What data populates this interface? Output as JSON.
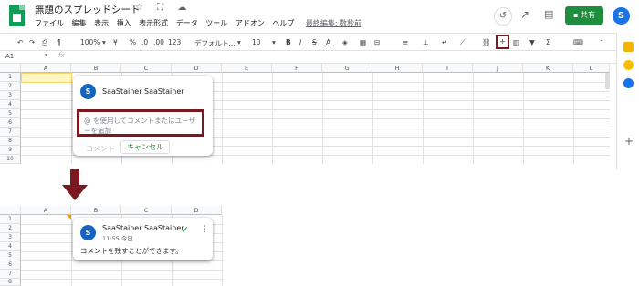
{
  "app": {
    "doc_title": "無題のスプレッドシート",
    "title_icons": "☆ ⛶ ☁",
    "menus": [
      "ファイル",
      "編集",
      "表示",
      "挿入",
      "表示形式",
      "データ",
      "ツール",
      "アドオン",
      "ヘルプ"
    ],
    "last_edit": "最終編集: 数秒前",
    "share_label": "共有",
    "user_initial": "S"
  },
  "toolbar": {
    "zoom": "100%",
    "currency": "¥",
    "percent": "%",
    "dec_less": ".0",
    "dec_more": ".00",
    "format_more": "123",
    "font": "デフォルト...",
    "font_size": "10",
    "bold": "B",
    "italic": "I",
    "strike": "S",
    "text_color": "A",
    "sigma": "Σ",
    "comment_icon": "comment-add-icon"
  },
  "formula_bar": {
    "cell_ref": "A1",
    "fx": "fx"
  },
  "grid": {
    "columns": [
      "A",
      "B",
      "C",
      "D",
      "E",
      "F",
      "G",
      "H",
      "I",
      "J",
      "K",
      "L"
    ],
    "rows_top": [
      "1",
      "2",
      "3",
      "4",
      "5",
      "6",
      "7",
      "8",
      "9",
      "10"
    ],
    "columns_bottom": [
      "A",
      "B",
      "C",
      "D"
    ],
    "rows_bottom": [
      "1",
      "2",
      "3",
      "4",
      "5",
      "6",
      "7",
      "8"
    ]
  },
  "comment_editor": {
    "initial": "S",
    "name": "SaaStainer SaaStainer",
    "placeholder_line1": "@ を使用してコメントまたはユーザ",
    "placeholder_line2": "ーを追加",
    "comment_button": "コメント",
    "cancel_button": "キャンセル"
  },
  "comment_posted": {
    "initial": "S",
    "name": "SaaStainer SaaStainer",
    "time": "11:55 今日",
    "text": "コメントを残すことができます。",
    "resolve_icon": "✓",
    "more_icon": "⋮"
  },
  "colors": {
    "highlight": "#7b1923",
    "sheets_green": "#0f9d58",
    "share_green": "#1e8e3e",
    "avatar_blue": "#1565c0"
  }
}
